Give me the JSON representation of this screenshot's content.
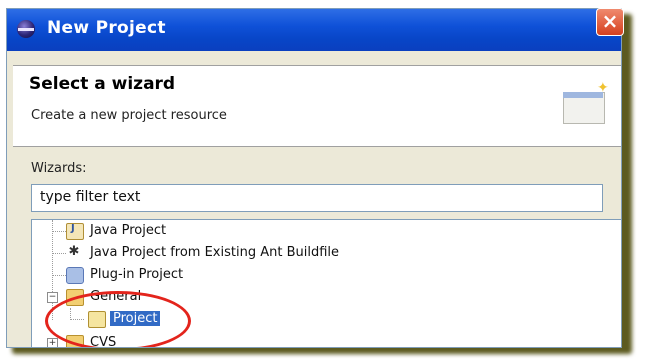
{
  "window": {
    "title": "New Project",
    "close_label": "×"
  },
  "header": {
    "title": "Select a wizard",
    "description": "Create a new project resource"
  },
  "wizards": {
    "label": "Wizards:",
    "filter_value": "type filter text"
  },
  "tree": {
    "items": [
      {
        "label": "Java Project",
        "icon": "java-project-icon"
      },
      {
        "label": "Java Project from Existing Ant Buildfile",
        "icon": "ant-icon"
      },
      {
        "label": "Plug-in Project",
        "icon": "plugin-project-icon"
      },
      {
        "label": "General",
        "icon": "folder-open-icon",
        "expanded": true
      },
      {
        "label": "Project",
        "icon": "project-icon",
        "selected": true
      },
      {
        "label": "CVS",
        "icon": "folder-icon",
        "expanded": false
      }
    ]
  },
  "colors": {
    "titlebar": "#0846c8",
    "selection": "#316ac5",
    "highlight_circle": "#e3241c"
  }
}
